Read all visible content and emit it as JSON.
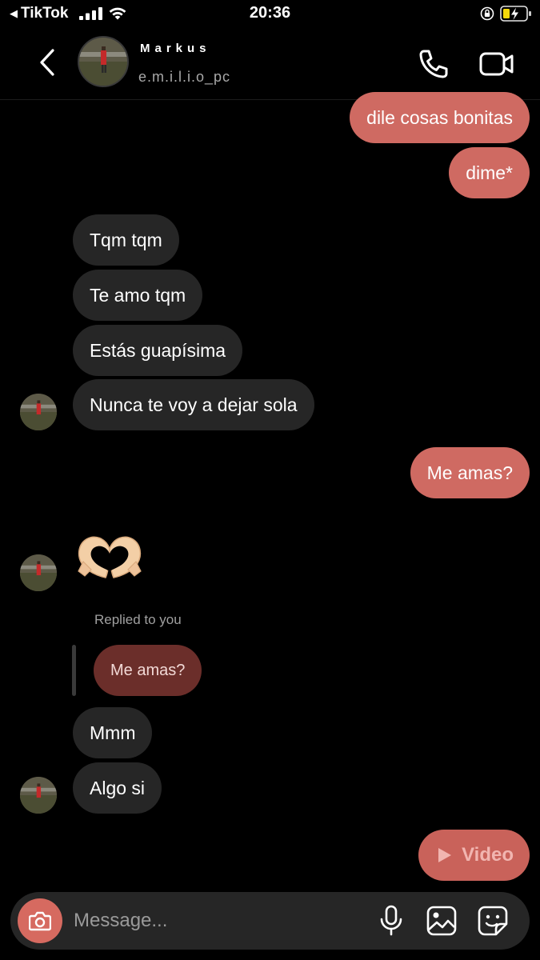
{
  "status_bar": {
    "back_app": "TikTok",
    "time": "20:36"
  },
  "header": {
    "display_name": "Markus",
    "username": "e.m.i.l.i.o_pc"
  },
  "messages": [
    {
      "side": "out",
      "text": "dile cosas bonitas"
    },
    {
      "side": "out",
      "text": "dime*"
    },
    {
      "side": "in",
      "text": "Tqm tqm"
    },
    {
      "side": "in",
      "text": "Te amo tqm"
    },
    {
      "side": "in",
      "text": "Estás guapísima"
    },
    {
      "side": "in",
      "text": "Nunca te voy a dejar sola"
    },
    {
      "side": "out",
      "text": "Me amas?"
    },
    {
      "side": "in",
      "emoji": "heart-hands"
    },
    {
      "side": "in",
      "text": "Mmm"
    },
    {
      "side": "in",
      "text": "Algo si"
    }
  ],
  "reply": {
    "label": "Replied to you",
    "quoted_text": "Me amas?"
  },
  "video_message": {
    "label": "Video"
  },
  "composer": {
    "placeholder": "Message..."
  },
  "colors": {
    "outgoing_bubble": "#cf6a62",
    "incoming_bubble": "#262626",
    "reply_bubble": "#6b2e2a",
    "camera_button": "#d66a60"
  }
}
